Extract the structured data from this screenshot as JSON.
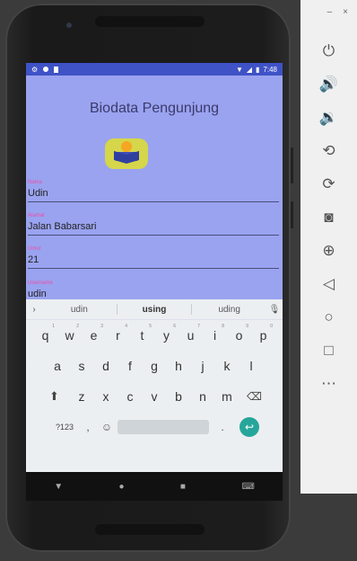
{
  "statusbar": {
    "time": "7:48"
  },
  "app": {
    "title": "Biodata Pengunjung",
    "fields": [
      {
        "label": "Nama",
        "value": "Udin"
      },
      {
        "label": "Alamat",
        "value": "Jalan Babarsari"
      },
      {
        "label": "Umur",
        "value": "21"
      },
      {
        "label": "Username",
        "value": "udin"
      }
    ]
  },
  "keyboard": {
    "suggestions": [
      "udin",
      "using",
      "uding"
    ],
    "row1": [
      "q",
      "w",
      "e",
      "r",
      "t",
      "y",
      "u",
      "i",
      "o",
      "p"
    ],
    "row1_hints": [
      "1",
      "2",
      "3",
      "4",
      "5",
      "6",
      "7",
      "8",
      "9",
      "0"
    ],
    "row2": [
      "a",
      "s",
      "d",
      "f",
      "g",
      "h",
      "j",
      "k",
      "l"
    ],
    "row3": [
      "z",
      "x",
      "c",
      "v",
      "b",
      "n",
      "m"
    ],
    "symbols": "?123",
    "comma": ",",
    "period": "."
  },
  "emulator": {
    "minimize": "–",
    "close": "×",
    "buttons": [
      "power-icon",
      "volume-up-icon",
      "volume-down-icon",
      "rotate-left-icon",
      "rotate-right-icon",
      "camera-icon",
      "zoom-icon",
      "back-icon",
      "home-icon",
      "overview-icon",
      "more-icon"
    ]
  },
  "colors": {
    "accent": "#e94fa8",
    "statusbar": "#3f52c6",
    "background": "#9aa3f0",
    "enter": "#26a69a"
  }
}
